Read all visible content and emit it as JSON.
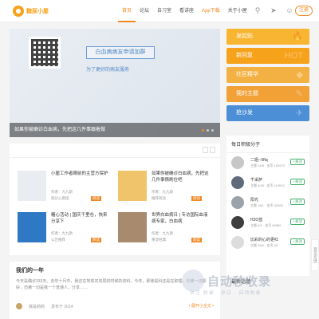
{
  "header": {
    "logo_text": "糖尿小屋",
    "nav": [
      "首页",
      "论坛",
      "自习室",
      "看讲座",
      "App下载",
      "关于小屋"
    ],
    "signup_label": "注册"
  },
  "banner": {
    "cta": "白血病病友申请加群",
    "sub": "为了更好的病友服务",
    "caption": "如果你被确诊白血病，先把这几件事跟着做"
  },
  "side_cards": [
    {
      "label": "发起贴",
      "color": "#f7b531",
      "deco": "🔥"
    },
    {
      "label": "新回复",
      "color": "#f7a21b",
      "deco": "HOT"
    },
    {
      "label": "社区精华",
      "color": "#f3b143",
      "deco": "◆"
    },
    {
      "label": "我的主题",
      "color": "#f1a136",
      "deco": "✎"
    },
    {
      "label": "抢沙发",
      "color": "#4d8fd6",
      "deco": "✈"
    }
  ],
  "news": [
    {
      "title": "小屋工作者眼前的主营方保护",
      "meta": "作者：九九斯",
      "src": "就诊心愿团",
      "tag": "阅读",
      "thumb": "#e9edf2"
    },
    {
      "title": "如果你被确诊白血病，先把这几件事情刷住吧",
      "meta": "作者：九九斯",
      "src": "推荐阅读",
      "tag": "阅读",
      "thumb": "#f0c46b"
    },
    {
      "title": "糖心活动 | 国庆千里仓，快来分享下",
      "meta": "作者：九九斯",
      "src": "公告推荐",
      "tag": "阅读",
      "thumb": "#2f78c4"
    },
    {
      "title": "世界白血病日 | 专访国际血液病专家，白血病",
      "meta": "作者：九九斯",
      "src": "重温经典",
      "tag": "阅读",
      "thumb": "#a88b6f"
    }
  ],
  "article": {
    "title": "我们的一年",
    "body": "今天是确诊333天。去年十月中，我还在地铁买双层的时候的资料。今年，即使是科还是在职理，仿佛一切都好，仿佛一切是我一个普通人，分享……",
    "author": "我是莉莉",
    "date": "发布于 2014",
    "more": "• 展开小全文 •"
  },
  "members": {
    "title": "每日积极分子",
    "list": [
      {
        "name": "二姐--5ftq",
        "stat": "主题 14/8 · 金币 102672",
        "follow": "+关注",
        "av": "#c7c7c7"
      },
      {
        "name": "千采萨",
        "stat": "主题 4/28 · 金币 119512",
        "follow": "+关注",
        "av": "#5f6a7a"
      },
      {
        "name": "阳光",
        "stat": "主题 18/1 · 金币 32000",
        "follow": "+关注",
        "av": "#9aa2aa"
      },
      {
        "name": "H2O蓝",
        "stat": "主题 4/1 · 金币 62089",
        "follow": "+关注",
        "av": "#3e3e3e"
      },
      {
        "name": "比彩的心的更红",
        "stat": "主题 25/9 · 金币 82",
        "follow": "+关注",
        "av": "#dcdcdc"
      }
    ],
    "bottom_title": "最新话题"
  },
  "watermark": {
    "text": "自动秒收录",
    "sub": "关注 收录 · 来访 · 自动收录"
  },
  "feedback": "意见反馈"
}
